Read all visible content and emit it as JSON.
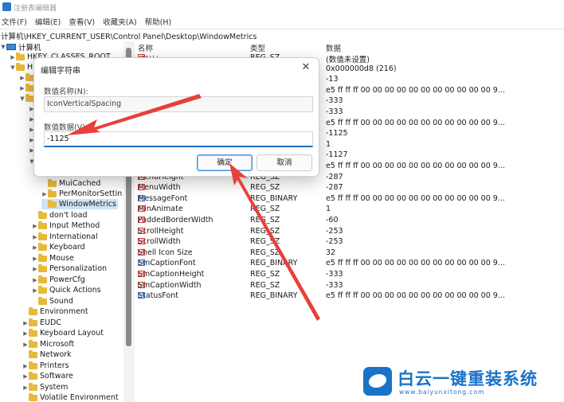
{
  "window": {
    "title": "注册表编辑器"
  },
  "menu": [
    "文件(F)",
    "编辑(E)",
    "查看(V)",
    "收藏夹(A)",
    "帮助(H)"
  ],
  "address": "计算机\\HKEY_CURRENT_USER\\Control Panel\\Desktop\\WindowMetrics",
  "tree": {
    "root": "计算机",
    "hkcr": "HKEY_CLASSES_ROOT",
    "hkcu_partial": "H",
    "muicached": "MuiCached",
    "permonitor": "PerMonitorSettin",
    "windowmetrics": "WindowMetrics",
    "items": [
      "don't load",
      "Input Method",
      "International",
      "Keyboard",
      "Mouse",
      "Personalization",
      "PowerCfg",
      "Quick Actions",
      "Sound",
      "Environment",
      "EUDC",
      "Keyboard Layout",
      "Microsoft",
      "Network",
      "Printers",
      "Software",
      "System",
      "Volatile Environment"
    ]
  },
  "list": {
    "headers": {
      "name": "名称",
      "type": "类型",
      "data": "数据"
    },
    "rows": [
      {
        "name": "(默认)",
        "type": "REG_SZ",
        "data": "(数值未设置)",
        "icon": "ab"
      },
      {
        "name": "",
        "type": "",
        "data": "0x000000d8 (216)",
        "icon": ""
      },
      {
        "name": "",
        "type": "",
        "data": "-13",
        "icon": ""
      },
      {
        "name": "",
        "type": "",
        "data": "e5 ff ff ff 00 00 00 00 00 00 00 00 00 00 00 9...",
        "icon": ""
      },
      {
        "name": "",
        "type": "",
        "data": "-333",
        "icon": ""
      },
      {
        "name": "",
        "type": "",
        "data": "-333",
        "icon": ""
      },
      {
        "name": "",
        "type": "",
        "data": "e5 ff ff ff 00 00 00 00 00 00 00 00 00 00 00 9...",
        "icon": ""
      },
      {
        "name": "",
        "type": "",
        "data": "-1125",
        "icon": ""
      },
      {
        "name": "",
        "type": "",
        "data": "1",
        "icon": ""
      },
      {
        "name": "",
        "type": "",
        "data": "-1127",
        "icon": ""
      },
      {
        "name": "",
        "type": "",
        "data": "e5 ff ff ff 00 00 00 00 00 00 00 00 00 00 00 9...",
        "icon": ""
      },
      {
        "name": "MenuHeight",
        "type": "REG_SZ",
        "data": "-287",
        "icon": "ab"
      },
      {
        "name": "MenuWidth",
        "type": "REG_SZ",
        "data": "-287",
        "icon": "ab"
      },
      {
        "name": "MessageFont",
        "type": "REG_BINARY",
        "data": "e5 ff ff ff 00 00 00 00 00 00 00 00 00 00 00 9...",
        "icon": "bin"
      },
      {
        "name": "MinAnimate",
        "type": "REG_SZ",
        "data": "1",
        "icon": "ab"
      },
      {
        "name": "PaddedBorderWidth",
        "type": "REG_SZ",
        "data": "-60",
        "icon": "ab"
      },
      {
        "name": "ScrollHeight",
        "type": "REG_SZ",
        "data": "-253",
        "icon": "ab"
      },
      {
        "name": "ScrollWidth",
        "type": "REG_SZ",
        "data": "-253",
        "icon": "ab"
      },
      {
        "name": "Shell Icon Size",
        "type": "REG_SZ",
        "data": "32",
        "icon": "ab"
      },
      {
        "name": "SmCaptionFont",
        "type": "REG_BINARY",
        "data": "e5 ff ff ff 00 00 00 00 00 00 00 00 00 00 00 9...",
        "icon": "bin"
      },
      {
        "name": "SmCaptionHeight",
        "type": "REG_SZ",
        "data": "-333",
        "icon": "ab"
      },
      {
        "name": "SmCaptionWidth",
        "type": "REG_SZ",
        "data": "-333",
        "icon": "ab"
      },
      {
        "name": "StatusFont",
        "type": "REG_BINARY",
        "data": "e5 ff ff ff 00 00 00 00 00 00 00 00 00 00 00 9...",
        "icon": "bin"
      }
    ]
  },
  "dialog": {
    "title": "编辑字符串",
    "close": "✕",
    "name_label": "数值名称(N):",
    "name_value": "IconVerticalSpacing",
    "data_label": "数值数据(V):",
    "data_value": "-1125",
    "ok": "确定",
    "cancel": "取消"
  },
  "watermark": {
    "text": "白云一键重装系统",
    "url": "www.baiyunxitong.com"
  },
  "colors": {
    "accent": "#1c6fbf",
    "arrow": "#e8403a",
    "folder": "#e8b93a",
    "brand": "#1a73c9"
  }
}
